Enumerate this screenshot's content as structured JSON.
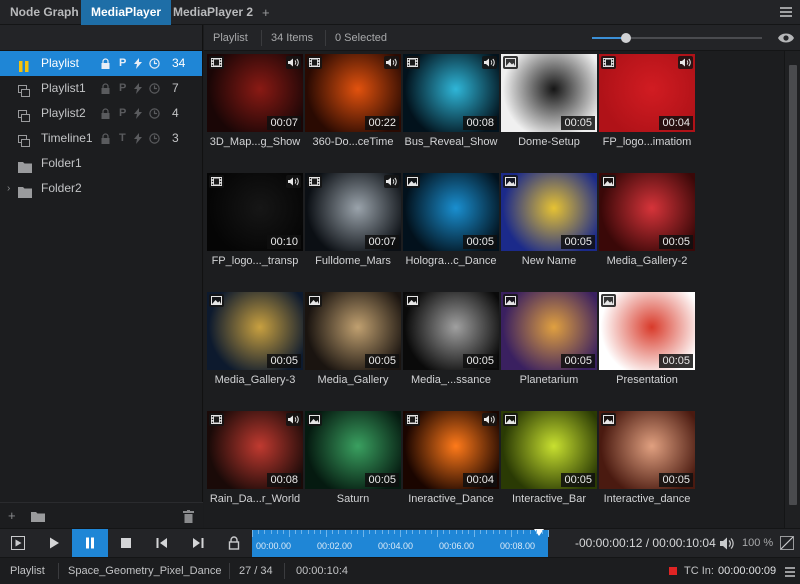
{
  "tabs": [
    {
      "label": "Node Graph"
    },
    {
      "label": "MediaPlayer"
    },
    {
      "label": "MediaPlayer 2"
    }
  ],
  "tab_add": "+",
  "playlists": [
    {
      "label": "Playlist",
      "flag1": "P",
      "count": "34",
      "selected": true
    },
    {
      "label": "Playlist1",
      "flag1": "P",
      "count": "7"
    },
    {
      "label": "Playlist2",
      "flag1": "P",
      "count": "4"
    },
    {
      "label": "Timeline1",
      "flag1": "T",
      "count": "3"
    },
    {
      "label": "Folder1"
    },
    {
      "label": "Folder2"
    }
  ],
  "grid_header": {
    "title": "Playlist",
    "items": "34 Items",
    "selected": "0 Selected",
    "zoom": 0.2
  },
  "media": [
    {
      "name": "3D_Map...g_Show",
      "duration": "00:07",
      "type": "video",
      "sound": true
    },
    {
      "name": "360-Do...ceTime",
      "duration": "00:22",
      "type": "video",
      "sound": true
    },
    {
      "name": "Bus_Reveal_Show",
      "duration": "00:08",
      "type": "video",
      "sound": true
    },
    {
      "name": "Dome-Setup",
      "duration": "00:05",
      "type": "image",
      "sound": false
    },
    {
      "name": "FP_logo...imatiom",
      "duration": "00:04",
      "type": "video",
      "sound": true
    },
    {
      "name": "FP_logo..._transp",
      "duration": "00:10",
      "type": "video",
      "sound": true
    },
    {
      "name": "Fulldome_Mars",
      "duration": "00:07",
      "type": "video",
      "sound": true
    },
    {
      "name": "Hologra...c_Dance",
      "duration": "00:05",
      "type": "image",
      "sound": false
    },
    {
      "name": "New Name",
      "duration": "00:05",
      "type": "image",
      "sound": false
    },
    {
      "name": "Media_Gallery-2",
      "duration": "00:05",
      "type": "image",
      "sound": false
    },
    {
      "name": "Media_Gallery-3",
      "duration": "00:05",
      "type": "image",
      "sound": false
    },
    {
      "name": "Media_Gallery",
      "duration": "00:05",
      "type": "image",
      "sound": false
    },
    {
      "name": "Media_...ssance",
      "duration": "00:05",
      "type": "image",
      "sound": false
    },
    {
      "name": "Planetarium",
      "duration": "00:05",
      "type": "image",
      "sound": false
    },
    {
      "name": "Presentation",
      "duration": "00:05",
      "type": "image",
      "sound": false
    },
    {
      "name": "Rain_Da...r_World",
      "duration": "00:08",
      "type": "video",
      "sound": true
    },
    {
      "name": "Saturn",
      "duration": "00:05",
      "type": "image",
      "sound": false
    },
    {
      "name": "Ineractive_Dance",
      "duration": "00:04",
      "type": "video",
      "sound": true
    },
    {
      "name": "Interactive_Bar",
      "duration": "00:05",
      "type": "image",
      "sound": false
    },
    {
      "name": "Interactive_dance",
      "duration": "00:05",
      "type": "image",
      "sound": false
    }
  ],
  "thumb_colors": [
    [
      "#1a0606",
      "#8a1a14"
    ],
    [
      "#2a0a02",
      "#e2520e"
    ],
    [
      "#02121c",
      "#2fb6d8"
    ],
    [
      "#f0f0f0",
      "#151515"
    ],
    [
      "#b01218",
      "#d11c22"
    ],
    [
      "#050505",
      "#161616"
    ],
    [
      "#0b0f14",
      "#9aa3ab"
    ],
    [
      "#02111c",
      "#1a8fd0"
    ],
    [
      "#1b2a8a",
      "#e6c233"
    ],
    [
      "#3a0808",
      "#d6343a"
    ],
    [
      "#0d1a2e",
      "#c8a040"
    ],
    [
      "#1a1410",
      "#c0a070"
    ],
    [
      "#0a0a0a",
      "#a0a0a0"
    ],
    [
      "#3a2060",
      "#e0a040"
    ],
    [
      "#ffffff",
      "#d83a2a"
    ],
    [
      "#1a0a08",
      "#c03a30"
    ],
    [
      "#051a10",
      "#3aa060"
    ],
    [
      "#1a0500",
      "#ff7a1a"
    ],
    [
      "#2a3a04",
      "#c8e030"
    ],
    [
      "#4a1a10",
      "#e0a080"
    ]
  ],
  "transport": {
    "timeline_labels": [
      "00:00.00",
      "00:02.00",
      "00:04.00",
      "00:06.00",
      "00:08.00"
    ],
    "position": 0.97,
    "timecode": "-00:00:00:12 / 00:00:10:04",
    "volume": "100 %"
  },
  "status": {
    "list": "Playlist",
    "media": "Space_Geometry_Pixel_Dance",
    "index": "27 / 34",
    "time": "00:00:10:4",
    "tc_label": "TC In:",
    "tc_value": "00:00:00:09"
  }
}
